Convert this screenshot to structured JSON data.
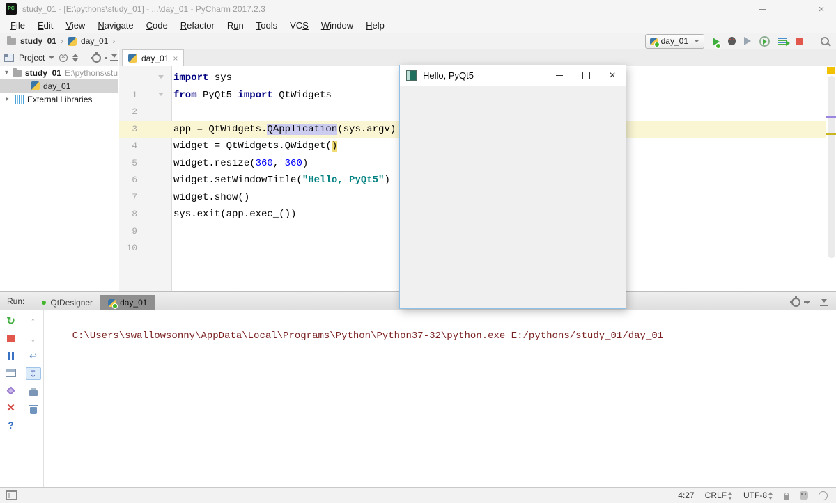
{
  "window": {
    "title": "study_01 - [E:\\pythons\\study_01] - ...\\day_01 - PyCharm 2017.2.3",
    "logo_text": "PC"
  },
  "menu": {
    "items": [
      "File",
      "Edit",
      "View",
      "Navigate",
      "Code",
      "Refactor",
      "Run",
      "Tools",
      "VCS",
      "Window",
      "Help"
    ]
  },
  "breadcrumbs": {
    "project": "study_01",
    "file": "day_01"
  },
  "toolbar": {
    "run_config": "day_01"
  },
  "project_panel": {
    "header_label": "Project",
    "root_label": "study_01",
    "root_path": "E:\\pythons\\stu",
    "file_label": "day_01",
    "external_label": "External Libraries"
  },
  "editor": {
    "tab": "day_01",
    "lines": [
      {
        "n": "1",
        "s": [
          {
            "t": "import"
          },
          {
            "t": " sys"
          }
        ]
      },
      {
        "n": "2",
        "s": [
          {
            "t": "from"
          },
          {
            "t": " PyQt5 "
          },
          {
            "t": "import"
          },
          {
            "t": " QtWidgets"
          }
        ]
      },
      {
        "n": "3",
        "s": []
      },
      {
        "n": "4",
        "s": [
          {
            "t": "app = QtWidgets."
          },
          {
            "t": "QApplication"
          },
          {
            "t": "(sys.argv)"
          }
        ]
      },
      {
        "n": "5",
        "s": [
          {
            "t": "widget = QtWidgets.QWidget("
          },
          {
            "t": ")"
          }
        ]
      },
      {
        "n": "6",
        "s": [
          {
            "t": "widget.resize("
          },
          {
            "t": "360"
          },
          {
            "t": ", "
          },
          {
            "t": "360"
          },
          {
            "t": ")"
          }
        ]
      },
      {
        "n": "7",
        "s": [
          {
            "t": "widget.setWindowTitle("
          },
          {
            "t": "\"Hello, PyQt5\""
          },
          {
            "t": ")"
          }
        ]
      },
      {
        "n": "8",
        "s": [
          {
            "t": "widget.show()"
          }
        ]
      },
      {
        "n": "9",
        "s": [
          {
            "t": "sys.exit(app.exec_())"
          }
        ]
      },
      {
        "n": "10",
        "s": []
      }
    ]
  },
  "run_panel": {
    "label": "Run:",
    "tabs": [
      "QtDesigner",
      "day_01"
    ]
  },
  "console": {
    "line1": "C:\\Users\\swallowsonny\\AppData\\Local\\Programs\\Python\\Python37-32\\python.exe E:/pythons/study_01/day_01"
  },
  "popup": {
    "title": "Hello, PyQt5"
  },
  "status": {
    "caret_position": "4:27",
    "line_separator": "CRLF",
    "encoding": "UTF-8"
  },
  "colors": {
    "run_green": "#3fae3f",
    "stop_red": "#e2574c",
    "current_line_bg": "#faf5d2",
    "token_selection_bg": "#ccccf0",
    "brace_match_bg": "#f0dc74",
    "keyword": "#000080",
    "string": "#008080",
    "number": "#0000ff",
    "console_text": "#7a2222",
    "popup_border": "#8fc0e8",
    "file_status_mark": "#f2c200"
  }
}
